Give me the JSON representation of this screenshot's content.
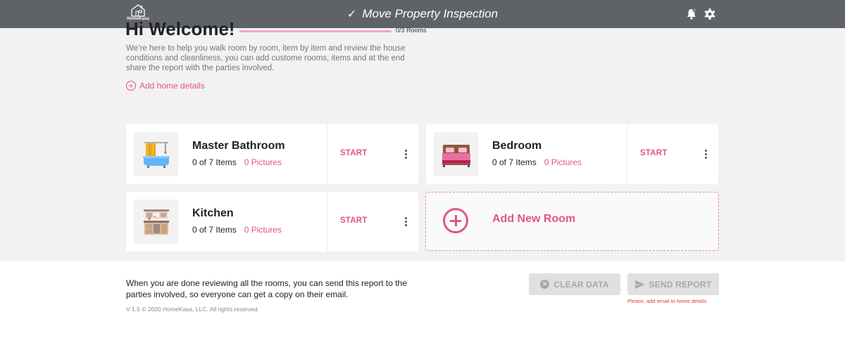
{
  "header": {
    "logo_text": "HomeKasa",
    "title": "Move Property Inspection",
    "check_icon": "check-icon",
    "bell_icon": "bell-icon",
    "settings_icon": "gear-icon",
    "notification_dot_color": "#4caf50"
  },
  "welcome": {
    "title": "Hi Welcome!",
    "progress_label": "0/3 Rooms",
    "rooms_done": 0,
    "rooms_total": 3,
    "intro": "We’re here to help you walk room by room, item by item and review the house conditions and cleanliness, you can add custome rooms, items and at the end share the report with the parties involved.",
    "add_home_label": "Add home details"
  },
  "rooms": [
    {
      "name": "Master Bathroom",
      "items": "0 of 7 Items",
      "pictures": "0 Pictures",
      "action": "START",
      "icon": "bathroom-icon"
    },
    {
      "name": "Bedroom",
      "items": "0 of 7 Items",
      "pictures": "0 Pictures",
      "action": "START",
      "icon": "bed-icon"
    },
    {
      "name": "Kitchen",
      "items": "0 of 7 Items",
      "pictures": "0 Pictures",
      "action": "START",
      "icon": "kitchen-icon"
    }
  ],
  "add_room": {
    "label": "Add New Room"
  },
  "footer": {
    "message": "When you are done reviewing all the rooms, you can send this report to the parties involved, so everyone can get a copy on their email.",
    "copyright": "V 1.5 © 2020 HomeKasa, LLC. All rights reserved.",
    "clear_label": "CLEAR DATA",
    "send_label": "SEND REPORT",
    "error": "Please, add email to home details"
  },
  "colors": {
    "accent": "#e05585",
    "header_bg": "#5f6368",
    "error": "#e53935"
  }
}
